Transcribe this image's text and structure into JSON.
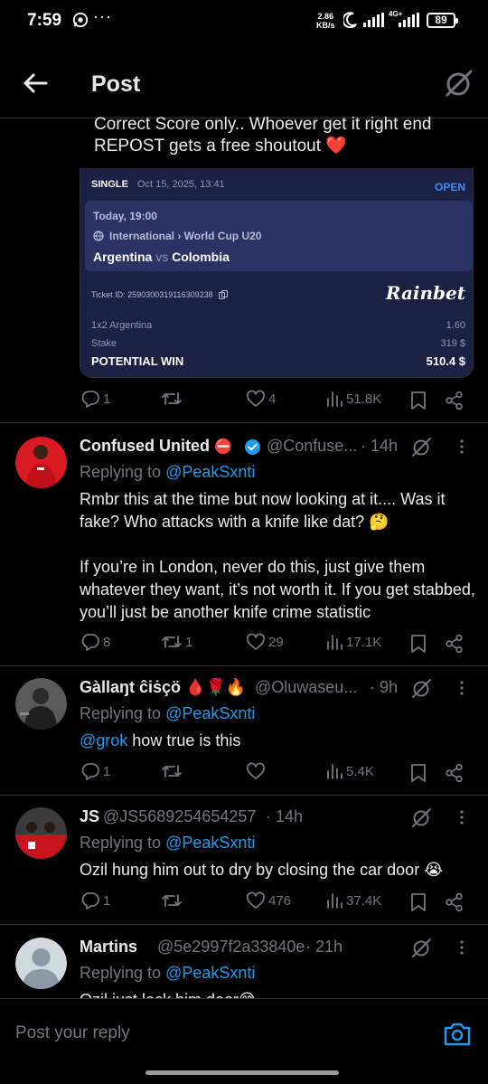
{
  "status_bar": {
    "time": "7:59",
    "more": "···",
    "speed_value": "2.86",
    "speed_unit": "KB/s",
    "network": "4G+",
    "battery": "89"
  },
  "header": {
    "title": "Post"
  },
  "tweet": {
    "text": "Correct Score only.. Whoever get it right end REPOST gets a free shoutout ❤️"
  },
  "bet_card": {
    "type": "SINGLE",
    "date": "Oct 15, 2025, 13:41",
    "status": "OPEN",
    "match_time": "Today, 19:00",
    "league": "International › World Cup U20",
    "home_team": "Argentina",
    "vs": "vs",
    "away_team": "Colombia",
    "ticket_id": "Ticket ID: 2590300319116309238",
    "brand": "Rainbet",
    "selection_label": "1x2 Argentina",
    "selection_odds": "1.60",
    "stake_label": "Stake",
    "stake_value": "319 $",
    "win_label": "POTENTIAL WIN",
    "win_value": "510.4 $"
  },
  "tweet_actions": {
    "replies": "1",
    "reposts": "",
    "likes": "4",
    "views": "51.8K"
  },
  "replies": [
    {
      "name": "Confused United",
      "badge": "⛔",
      "handle": "@Confuse...",
      "time": "· 14h",
      "replying_prefix": "Replying to",
      "replying_to": "@PeakSxnti",
      "body_p1": "Rmbr this at the time but now looking at it.... Was it fake? Who attacks with a knife like dat? 🤔",
      "body_p2": "If you’re in London, never do this, just give them whatever they want, it’s not worth it. If you get stabbed, you’ll just be another knife crime statistic",
      "replies": "8",
      "reposts": "1",
      "likes": "29",
      "views": "17.1K"
    },
    {
      "name": "Gàllaŋt ĉiṡçö 🩸🌹🔥",
      "handle": "@Oluwaseu...",
      "time": "· 9h",
      "replying_prefix": "Replying to",
      "replying_to": "@PeakSxnti",
      "body_mention": "@grok",
      "body_text": " how true is this",
      "replies": "1",
      "reposts": "",
      "likes": "",
      "views": "5.4K"
    },
    {
      "name": "JS",
      "handle": "@JS5689254654257",
      "time": "· 14h",
      "replying_prefix": "Replying to",
      "replying_to": "@PeakSxnti",
      "body": "Ozil hung him out to dry by closing the car door 😭",
      "replies": "1",
      "reposts": "",
      "likes": "476",
      "views": "37.4K"
    },
    {
      "name": "Martins",
      "handle": "@5e2997f2a33840e",
      "time": "· 21h",
      "replying_prefix": "Replying to",
      "replying_to": "@PeakSxnti",
      "body": "Ozil just lock him door😅"
    }
  ],
  "compose": {
    "placeholder": "Post your reply"
  },
  "colors": {
    "background": "#000000",
    "text": "#e7e9ea",
    "muted": "#71767b",
    "link": "#1d9bf0",
    "card": "#1b2142",
    "card_inner": "#2a3363",
    "verified": "#1d9bf0"
  }
}
